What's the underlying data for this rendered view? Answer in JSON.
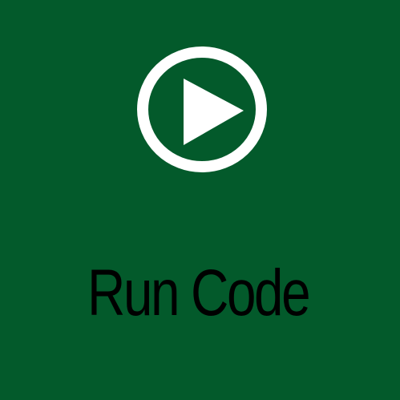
{
  "tile": {
    "label": "Run Code",
    "icon": "play-circle-icon"
  },
  "colors": {
    "background": "#035a2b",
    "icon": "#ffffff",
    "label": "#000000"
  }
}
